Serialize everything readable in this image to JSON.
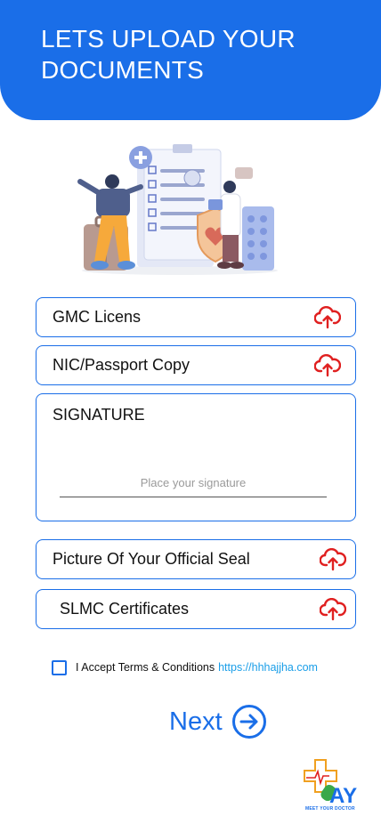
{
  "header": {
    "title": "LETS UPLOAD YOUR DOCUMENTS"
  },
  "uploads": [
    {
      "label": "GMC Licens",
      "icon": "upload-cloud-icon"
    },
    {
      "label": "NIC/Passport Copy",
      "icon": "upload-cloud-icon"
    },
    {
      "label": "Picture Of Your Official Seal",
      "icon": "upload-cloud-icon"
    },
    {
      "label": "SLMC Certificates",
      "icon": "upload-cloud-icon"
    }
  ],
  "signature": {
    "title": "SIGNATURE",
    "placeholder": "Place your signature"
  },
  "terms": {
    "text": "I Accept Terms & Conditions",
    "link": "https://hhhajjha.com",
    "checked": false
  },
  "next": {
    "label": "Next"
  },
  "logo": {
    "letters": "AY",
    "tagline": "MEET YOUR DOCTOR"
  },
  "colors": {
    "primary": "#1a6ee8",
    "upload_icon": "#e02020",
    "link": "#1a9ee8"
  }
}
